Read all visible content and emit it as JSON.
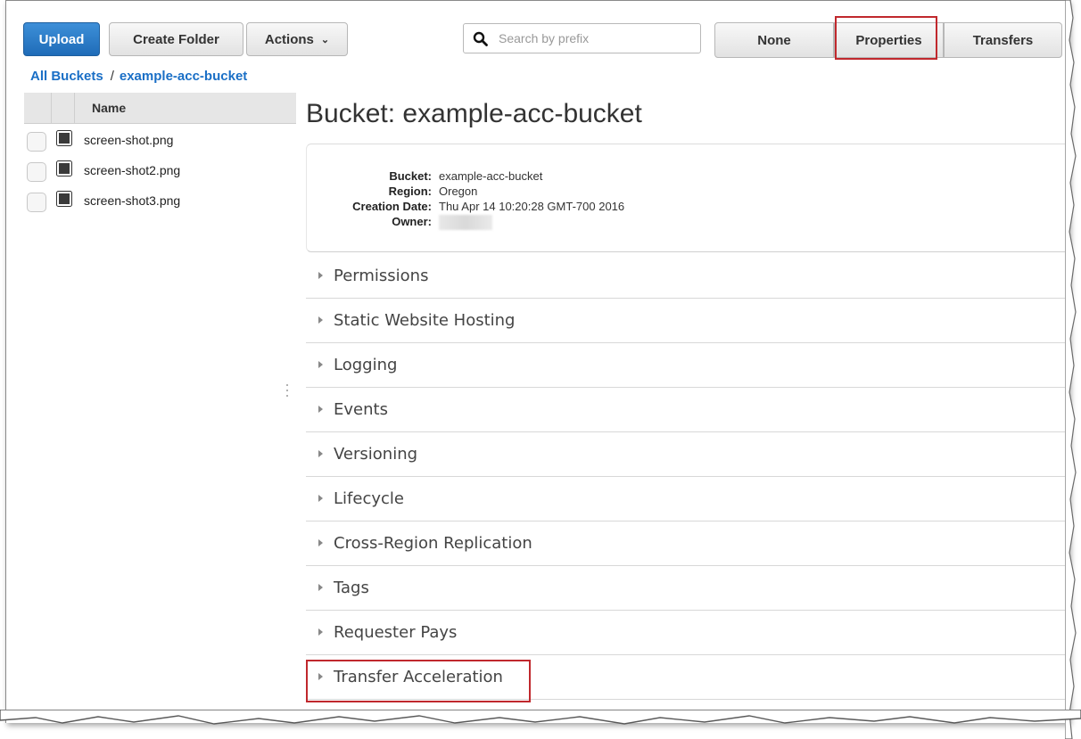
{
  "toolbar": {
    "upload_label": "Upload",
    "create_folder_label": "Create Folder",
    "actions_label": "Actions",
    "search_placeholder": "Search by prefix",
    "view_options": [
      "None",
      "Properties",
      "Transfers"
    ]
  },
  "breadcrumb": {
    "root": "All Buckets",
    "separator": "/",
    "current": "example-acc-bucket"
  },
  "file_list": {
    "column_header": "Name",
    "files": [
      "screen-shot.png",
      "screen-shot2.png",
      "screen-shot3.png"
    ]
  },
  "bucket": {
    "title": "Bucket: example-acc-bucket",
    "details": [
      {
        "label": "Bucket:",
        "value": "example-acc-bucket"
      },
      {
        "label": "Region:",
        "value": "Oregon"
      },
      {
        "label": "Creation Date:",
        "value": "Thu Apr 14 10:20:28 GMT-700 2016"
      },
      {
        "label": "Owner:",
        "value": ""
      }
    ]
  },
  "sections": [
    "Permissions",
    "Static Website Hosting",
    "Logging",
    "Events",
    "Versioning",
    "Lifecycle",
    "Cross-Region Replication",
    "Tags",
    "Requester Pays",
    "Transfer Acceleration"
  ],
  "colors": {
    "primary_button": "#1f6cb8",
    "link": "#1a6fc6",
    "highlight": "#c0282d"
  }
}
